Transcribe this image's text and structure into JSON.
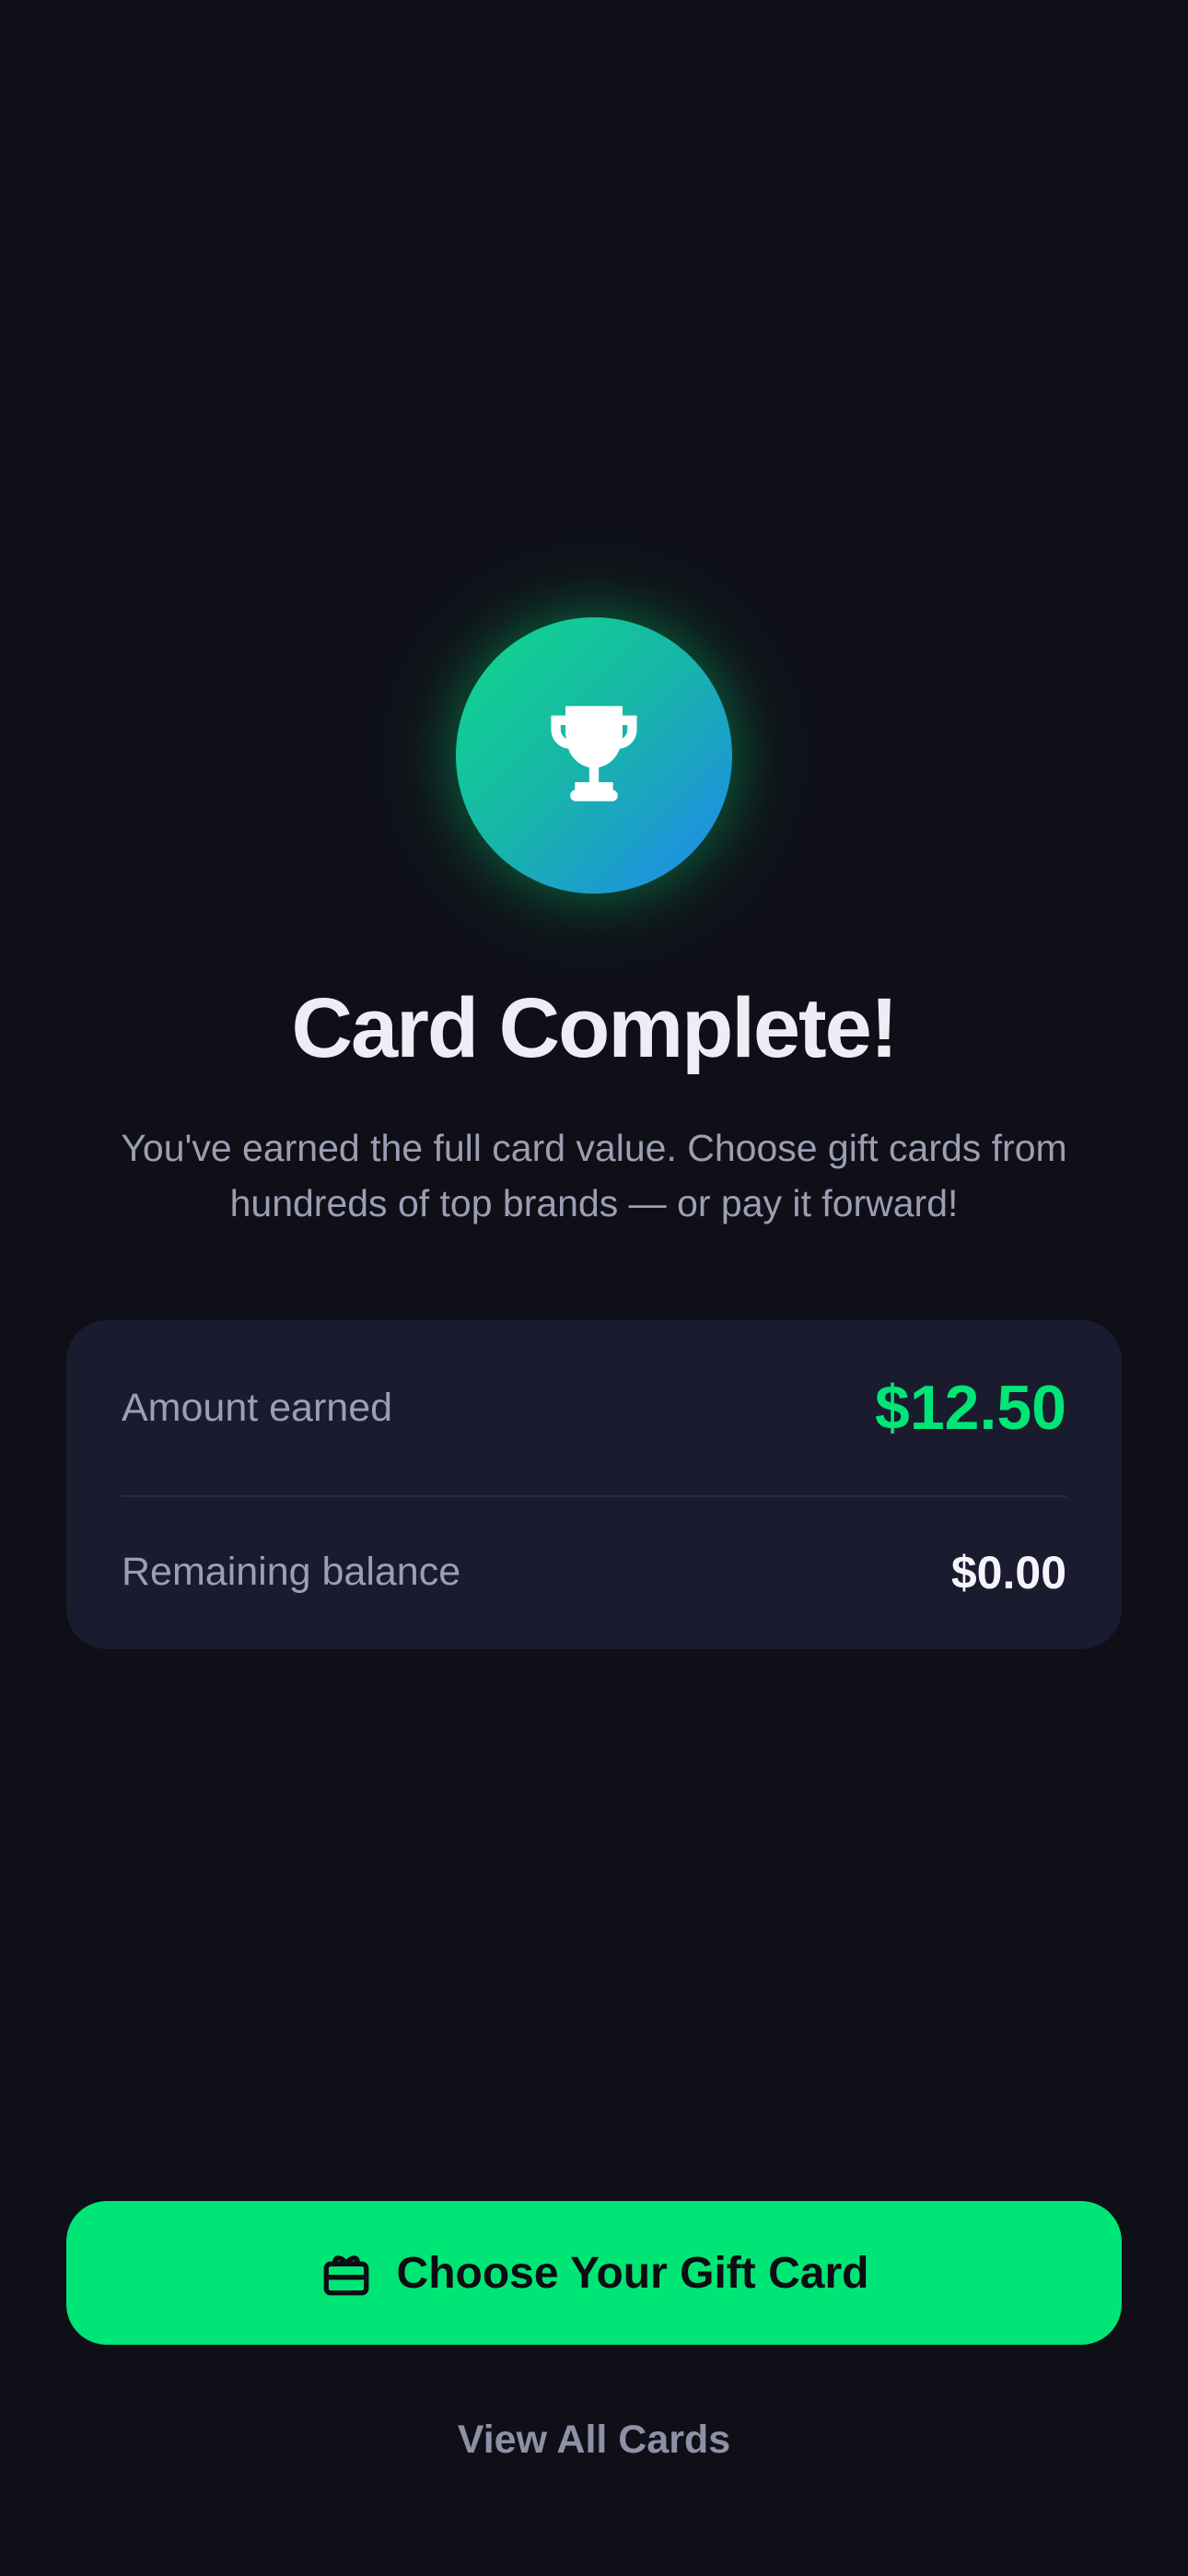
{
  "hero": {
    "icon": "trophy-icon",
    "title": "Card Complete!",
    "subtitle": "You've earned the full card value. Choose gift cards from hundreds of top brands — or pay it forward!"
  },
  "summary": {
    "amount_earned_label": "Amount earned",
    "amount_earned_value": "$12.50",
    "remaining_label": "Remaining balance",
    "remaining_value": "$0.00"
  },
  "actions": {
    "primary_icon": "gift-icon",
    "primary_label": "Choose Your Gift Card",
    "secondary_label": "View All Cards"
  },
  "colors": {
    "background": "#0f0f18",
    "accent": "#00e676",
    "card": "#1b1b2f",
    "gradient_start": "#0fd98a",
    "gradient_end": "#2087ef"
  }
}
